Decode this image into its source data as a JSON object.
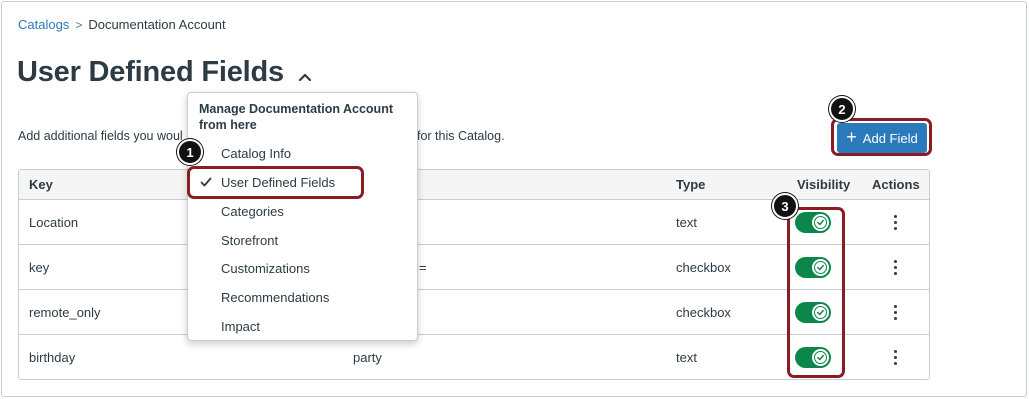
{
  "breadcrumb": {
    "root": "Catalogs",
    "separator": ">",
    "current": "Documentation Account"
  },
  "page": {
    "title": "User Defined Fields",
    "intro_start": "Add additional fields you woul",
    "intro_end": "for this Catalog."
  },
  "toolbar": {
    "add_field_label": "Add Field",
    "add_field_icon": "plus-icon"
  },
  "menu": {
    "heading": "Manage Documentation Account from here",
    "selected_icon": "checkmark-icon",
    "items": [
      {
        "label": "Catalog Info",
        "selected": false
      },
      {
        "label": "User Defined Fields",
        "selected": true
      },
      {
        "label": "Categories",
        "selected": false
      },
      {
        "label": "Storefront",
        "selected": false
      },
      {
        "label": "Customizations",
        "selected": false
      },
      {
        "label": "Recommendations",
        "selected": false
      },
      {
        "label": "Impact",
        "selected": false
      }
    ]
  },
  "table": {
    "columns": {
      "key": "Key",
      "name": "",
      "type": "Type",
      "visibility": "Visibility",
      "actions": "Actions"
    },
    "rows": [
      {
        "key": "Location",
        "name": "",
        "type": "text",
        "visible": true
      },
      {
        "key": "key",
        "name": "=",
        "type": "checkbox",
        "visible": true
      },
      {
        "key": "remote_only",
        "name": "",
        "type": "checkbox",
        "visible": true
      },
      {
        "key": "birthday",
        "name": "party",
        "type": "text",
        "visible": true
      }
    ]
  },
  "annotations": {
    "step1": "1",
    "step2": "2",
    "step3": "3",
    "highlight_color": "#8c1c24"
  },
  "colors": {
    "link": "#2b7abc",
    "primary_button": "#2b7abc",
    "toggle_on": "#0b874b",
    "text": "#2d3b45"
  }
}
